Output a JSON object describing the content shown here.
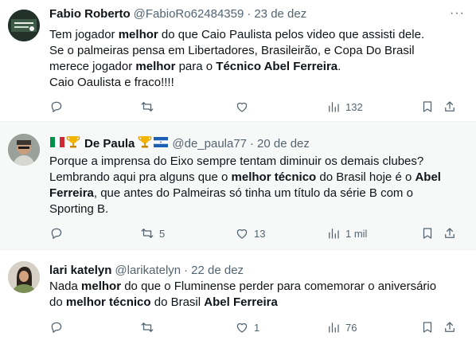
{
  "tweets": [
    {
      "name": "Fabio Roberto",
      "handle": "@FabioRo62484359",
      "sep": "·",
      "date": "23 de dez",
      "lines": [
        [
          {
            "t": "Tem jogador "
          },
          {
            "t": "melhor",
            "b": true
          },
          {
            "t": " do que Caio Paulista pelos video que assisti dele."
          }
        ],
        [
          {
            "t": "Se o palmeiras pensa em Libertadores,  Brasileirão,  e Copa Do Brasil"
          }
        ],
        [
          {
            "t": "merece jogador "
          },
          {
            "t": "melhor",
            "b": true
          },
          {
            "t": " para o "
          },
          {
            "t": "Técnico Abel Ferreira",
            "b": true
          },
          {
            "t": "."
          }
        ],
        [
          {
            "t": "Caio Oaulista e fraco!!!!"
          }
        ]
      ],
      "replies": "",
      "retweets": "",
      "likes": "",
      "views": "132"
    },
    {
      "name": "De Paula",
      "handle": "@de_paula77",
      "sep": "·",
      "date": "20 de dez",
      "lines": [
        [
          {
            "t": "Porque a imprensa do Eixo sempre tentam diminuir os demais clubes?"
          }
        ],
        [
          {
            "t": "Lembrando aqui pra alguns que o "
          },
          {
            "t": "melhor técnico",
            "b": true
          },
          {
            "t": " do Brasil hoje é o "
          },
          {
            "t": "Abel",
            "b": true
          }
        ],
        [
          {
            "t": "Ferreira",
            "b": true
          },
          {
            "t": ", que antes do Palmeiras só tinha um título da série B  com o"
          }
        ],
        [
          {
            "t": "Sporting B."
          }
        ]
      ],
      "replies": "",
      "retweets": "5",
      "likes": "13",
      "views": "1 mil"
    },
    {
      "name": "lari katelyn",
      "handle": "@larikatelyn",
      "sep": "·",
      "date": "22 de dez",
      "lines": [
        [
          {
            "t": "Nada "
          },
          {
            "t": "melhor",
            "b": true
          },
          {
            "t": " do que o Fluminense perder para comemorar o aniversário"
          }
        ],
        [
          {
            "t": "do "
          },
          {
            "t": "melhor técnico",
            "b": true
          },
          {
            "t": " do Brasil "
          },
          {
            "t": "Abel Ferreira",
            "b": true
          }
        ]
      ],
      "replies": "",
      "retweets": "",
      "likes": "1",
      "views": "76"
    }
  ],
  "icons": {
    "reply": "reply-icon",
    "retweet": "retweet-icon",
    "like": "heart-icon",
    "views": "views-icon",
    "bookmark": "bookmark-icon",
    "share": "share-icon",
    "more": "more-icon"
  },
  "more_label": "···",
  "colors": {
    "text": "#0f1419",
    "secondary": "#536471",
    "separator": "#eff3f4",
    "hover_bg": "#f7f9f9"
  }
}
